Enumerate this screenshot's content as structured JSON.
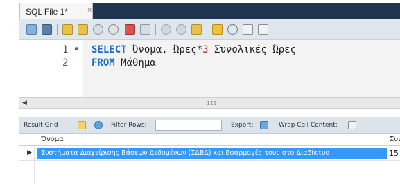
{
  "tab": {
    "title": "SQL File 1*",
    "close_glyph": "×"
  },
  "toolbar": {
    "icons": [
      "open-file-icon",
      "save-icon",
      "execute-icon",
      "execute-selection-icon",
      "find-icon",
      "stop-icon",
      "error-stop-icon",
      "toggle-output-icon",
      "commit-icon",
      "rollback-icon",
      "autocommit-icon",
      "beautify-icon",
      "search-icon",
      "invisible-chars-icon",
      "wrap-icon"
    ]
  },
  "editor": {
    "line_numbers": [
      "1",
      "2"
    ],
    "line1_marker": "•",
    "line1": {
      "kw": "SELECT",
      "rest1": " Όνομα, Ώρες",
      "op": "*",
      "num": "3",
      "rest2": " Συνολικές_Ώρες"
    },
    "line2": {
      "kw": "FROM",
      "rest": " Μάθημα"
    }
  },
  "scrollbar": {
    "left_arrow": "◀",
    "grip": "III"
  },
  "result_toolbar": {
    "result_grid_label": "Result Grid",
    "filter_label": "Filter Rows:",
    "filter_value": "",
    "export_label": "Export:",
    "wrap_label": "Wrap Cell Content:"
  },
  "grid": {
    "columns": [
      "Όνομα",
      "Συνολ"
    ],
    "rows": [
      {
        "marker": "▶",
        "name": "Συστήματα Διαχείρισης Βάσεων Δεδομένων (ΣΔΒΔ) και Εφαρμογές τους στο Διαδίκτυο",
        "total": "15"
      }
    ]
  },
  "colors": {
    "tabbar": "#1f3550",
    "keyword": "#1b6ec2",
    "number": "#a83226",
    "selection": "#3399ff"
  }
}
